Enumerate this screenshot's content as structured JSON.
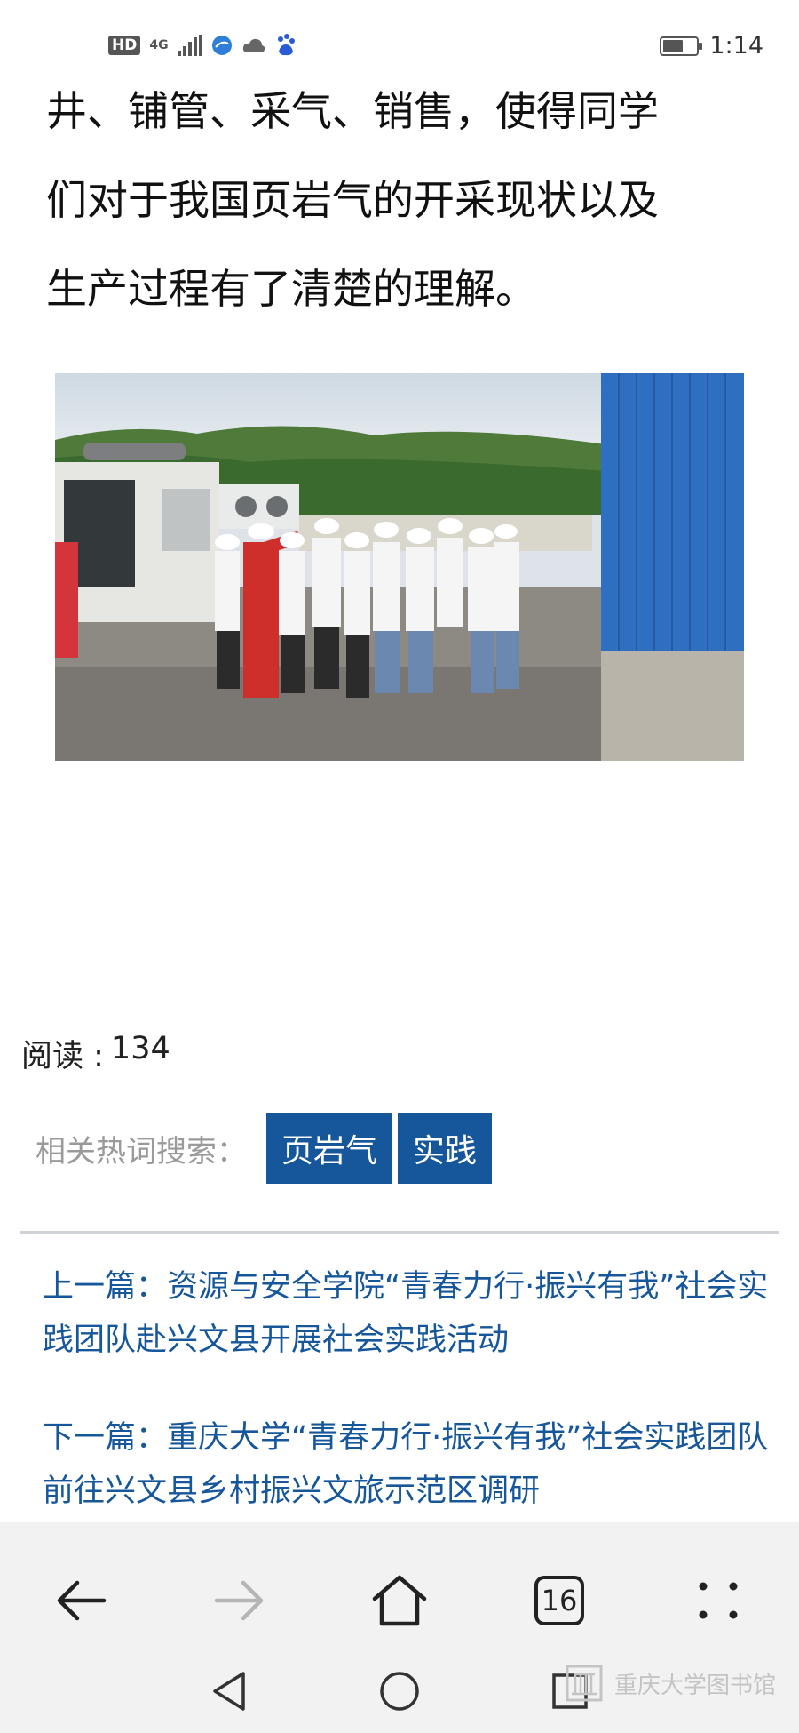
{
  "status_bar": {
    "hd": "HD",
    "network": "4G",
    "time": "1:14"
  },
  "article": {
    "lines": [
      "井、铺管、采气、销售，使得同学",
      "们对于我国页岩气的开采现状以及",
      "生产过程有了清楚的理解。"
    ]
  },
  "stats": {
    "reads_label": "阅读 :",
    "reads_count": "134"
  },
  "tags": {
    "label": "相关热词搜索：",
    "items": [
      "页岩气",
      "实践"
    ]
  },
  "navigation": {
    "prev": "上一篇：资源与安全学院“青春力行·振兴有我”社会实践团队赴兴文县开展社会实践活动",
    "next": "下一篇：重庆大学“青春力行·振兴有我”社会实践团队前往兴文县乡村振兴文旅示范区调研"
  },
  "browser_toolbar": {
    "tab_count": "16"
  },
  "watermark": {
    "text": "重庆大学图书馆"
  },
  "colors": {
    "accent": "#16569a",
    "toolbar_bg": "#f2f2f2"
  }
}
